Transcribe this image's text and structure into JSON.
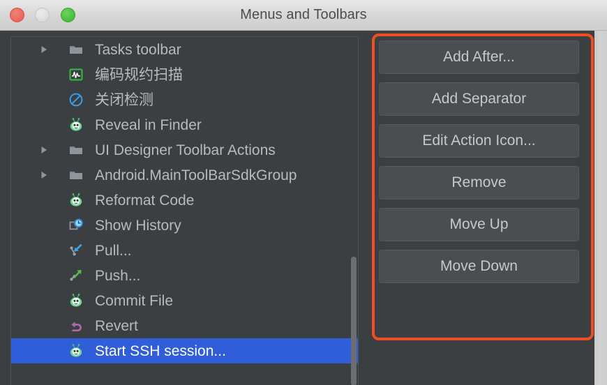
{
  "window": {
    "title": "Menus and Toolbars",
    "traffic_lights": [
      {
        "name": "close",
        "color": "#e8675b"
      },
      {
        "name": "minimize",
        "color": "#dcdcdc"
      },
      {
        "name": "maximize",
        "color": "#44bf3b"
      }
    ]
  },
  "tree": {
    "selected_index": 12,
    "selection_color": "#2f5ed8",
    "rows": [
      {
        "label": "Tasks toolbar",
        "icon": "folder-icon",
        "expandable": true,
        "cjk": false
      },
      {
        "label": "编码规约扫描",
        "icon": "code-inspection-icon",
        "expandable": false,
        "cjk": true
      },
      {
        "label": "关闭检测",
        "icon": "no-entry-icon",
        "expandable": false,
        "cjk": true
      },
      {
        "label": "Reveal in Finder",
        "icon": "alien-icon",
        "expandable": false,
        "cjk": false
      },
      {
        "label": "UI Designer Toolbar Actions",
        "icon": "folder-icon",
        "expandable": true,
        "cjk": false
      },
      {
        "label": "Android.MainToolBarSdkGroup",
        "icon": "folder-icon",
        "expandable": true,
        "cjk": false
      },
      {
        "label": "Reformat Code",
        "icon": "alien-icon",
        "expandable": false,
        "cjk": false
      },
      {
        "label": "Show History",
        "icon": "history-clock-icon",
        "expandable": false,
        "cjk": false
      },
      {
        "label": "Pull...",
        "icon": "vcs-pull-icon",
        "expandable": false,
        "cjk": false
      },
      {
        "label": "Push...",
        "icon": "vcs-push-icon",
        "expandable": false,
        "cjk": false
      },
      {
        "label": "Commit File",
        "icon": "alien-icon",
        "expandable": false,
        "cjk": false
      },
      {
        "label": "Revert",
        "icon": "revert-arrow-icon",
        "expandable": false,
        "cjk": false
      },
      {
        "label": "Start SSH session...",
        "icon": "alien-icon",
        "expandable": false,
        "cjk": false
      }
    ]
  },
  "actions": {
    "highlight_color": "#f04d22",
    "buttons": [
      {
        "label": "Add After...",
        "name": "add-after-button"
      },
      {
        "label": "Add Separator",
        "name": "add-separator-button"
      },
      {
        "label": "Edit Action Icon...",
        "name": "edit-action-icon-button"
      },
      {
        "label": "Remove",
        "name": "remove-button"
      },
      {
        "label": "Move Up",
        "name": "move-up-button"
      },
      {
        "label": "Move Down",
        "name": "move-down-button"
      }
    ]
  }
}
